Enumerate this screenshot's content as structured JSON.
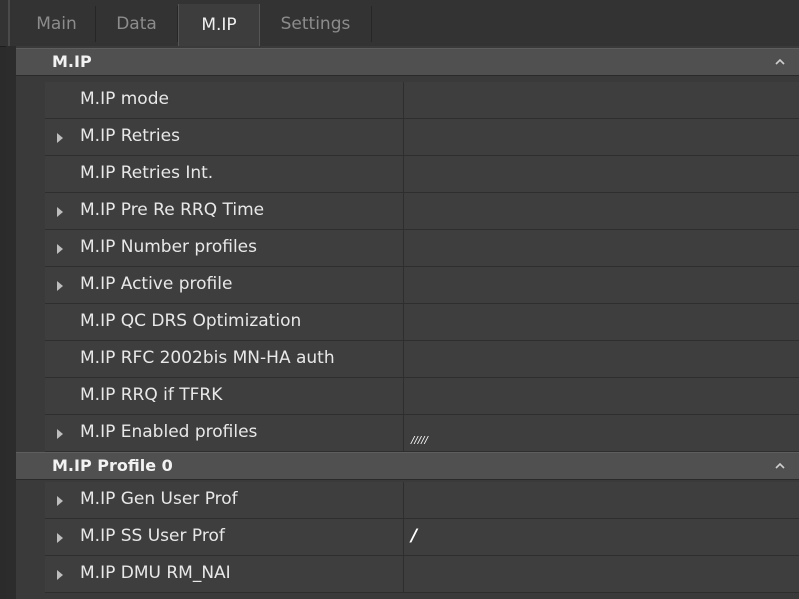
{
  "tabs": [
    {
      "label": "Main",
      "active": false
    },
    {
      "label": "Data",
      "active": false
    },
    {
      "label": "M.IP",
      "active": true
    },
    {
      "label": "Settings",
      "active": false
    }
  ],
  "groups": [
    {
      "title": "M.IP",
      "rows": [
        {
          "label": "M.IP mode",
          "value": "",
          "expandable": false
        },
        {
          "label": "M.IP Retries",
          "value": "",
          "expandable": true
        },
        {
          "label": "M.IP Retries Int.",
          "value": "",
          "expandable": false
        },
        {
          "label": "M.IP Pre Re RRQ Time",
          "value": "",
          "expandable": true
        },
        {
          "label": "M.IP Number profiles",
          "value": "",
          "expandable": true
        },
        {
          "label": "M.IP Active profile",
          "value": "",
          "expandable": true
        },
        {
          "label": "M.IP QC DRS Optimization",
          "value": "",
          "expandable": false
        },
        {
          "label": "M.IP RFC 2002bis MN-HA auth",
          "value": "",
          "expandable": false
        },
        {
          "label": "M.IP RRQ if TFRK",
          "value": "",
          "expandable": false
        },
        {
          "label": "M.IP Enabled profiles",
          "value": "/////",
          "expandable": true
        }
      ]
    },
    {
      "title": "M.IP Profile 0",
      "rows": [
        {
          "label": "M.IP Gen User Prof",
          "value": "",
          "expandable": true
        },
        {
          "label": "M.IP SS User Prof",
          "value": "/",
          "expandable": true
        },
        {
          "label": "M.IP DMU RM_NAI",
          "value": "",
          "expandable": true
        }
      ]
    }
  ],
  "colors": {
    "background": "#2b2b2b",
    "group_header": "#505050",
    "row": "#3e3e3e",
    "text": "#e8e8e8"
  },
  "icons": {
    "group_collapse": "chevron-up-icon",
    "row_expander": "triangle-right-icon"
  }
}
